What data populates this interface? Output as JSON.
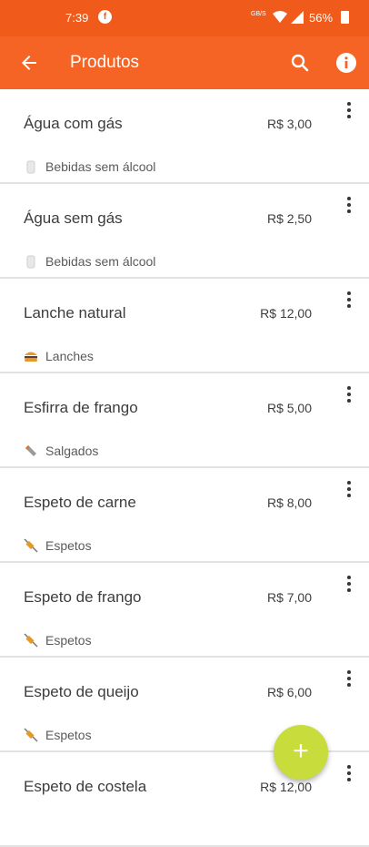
{
  "status_bar": {
    "time": "7:39",
    "notification_badge": "f",
    "network": "GB/S",
    "battery_percent": "56%"
  },
  "app_bar": {
    "title": "Produtos",
    "icons": [
      "back-arrow-icon",
      "search-icon",
      "info-icon"
    ],
    "color": "#f56424"
  },
  "products": [
    {
      "name": "Água com gás",
      "price": "R$ 3,00",
      "category": "Bebidas sem álcool",
      "category_icon": "bottle-icon"
    },
    {
      "name": "Água sem gás",
      "price": "R$ 2,50",
      "category": "Bebidas sem álcool",
      "category_icon": "bottle-icon"
    },
    {
      "name": "Lanche natural",
      "price": "R$ 12,00",
      "category": "Lanches",
      "category_icon": "burger-icon"
    },
    {
      "name": "Esfirra de frango",
      "price": "R$ 5,00",
      "category": "Salgados",
      "category_icon": "savory-icon"
    },
    {
      "name": "Espeto de carne",
      "price": "R$ 8,00",
      "category": "Espetos",
      "category_icon": "skewer-icon"
    },
    {
      "name": "Espeto de frango",
      "price": "R$ 7,00",
      "category": "Espetos",
      "category_icon": "skewer-icon"
    },
    {
      "name": "Espeto de queijo",
      "price": "R$ 6,00",
      "category": "Espetos",
      "category_icon": "skewer-icon"
    },
    {
      "name": "Espeto de costela",
      "price": "R$ 12,00",
      "category": "",
      "category_icon": ""
    }
  ],
  "fab": {
    "icon": "plus-icon",
    "label": "+",
    "color": "#c8dc3c"
  }
}
